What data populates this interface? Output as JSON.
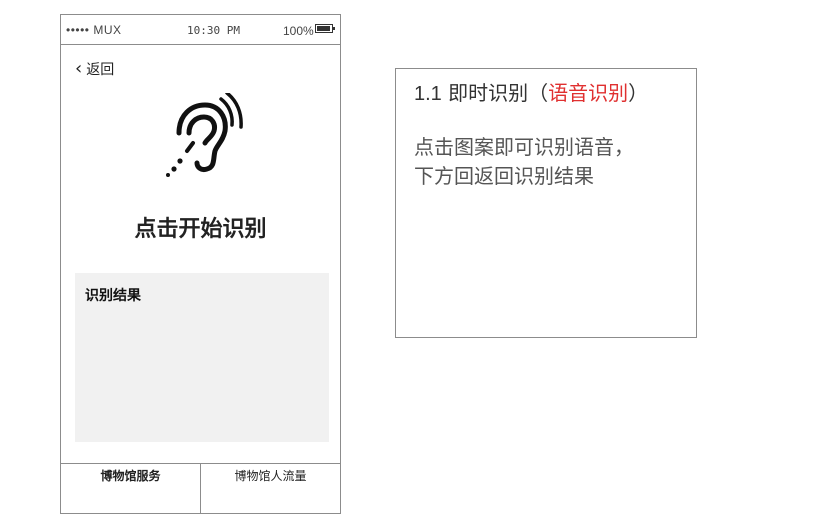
{
  "status_bar": {
    "carrier": "••••• MUX",
    "time": "10:30 PM",
    "battery": "100%"
  },
  "nav": {
    "back_label": "返回"
  },
  "main": {
    "icon": "ear-hearing-icon",
    "start_label": "点击开始识别",
    "result_label": "识别结果"
  },
  "tabs": [
    {
      "label": "博物馆服务",
      "active": true
    },
    {
      "label": "博物馆人流量",
      "active": false
    }
  ],
  "note": {
    "title_number": "1.1",
    "title_main": "即时识别",
    "title_open": "（",
    "title_highlight": "语音识别",
    "title_close": "）",
    "body_line1": "点击图案即可识别语音，",
    "body_line2": "下方回返回识别结果"
  },
  "colors": {
    "highlight": "#e03030",
    "result_bg": "#f1f1f1",
    "frame": "#8c8c8c"
  }
}
